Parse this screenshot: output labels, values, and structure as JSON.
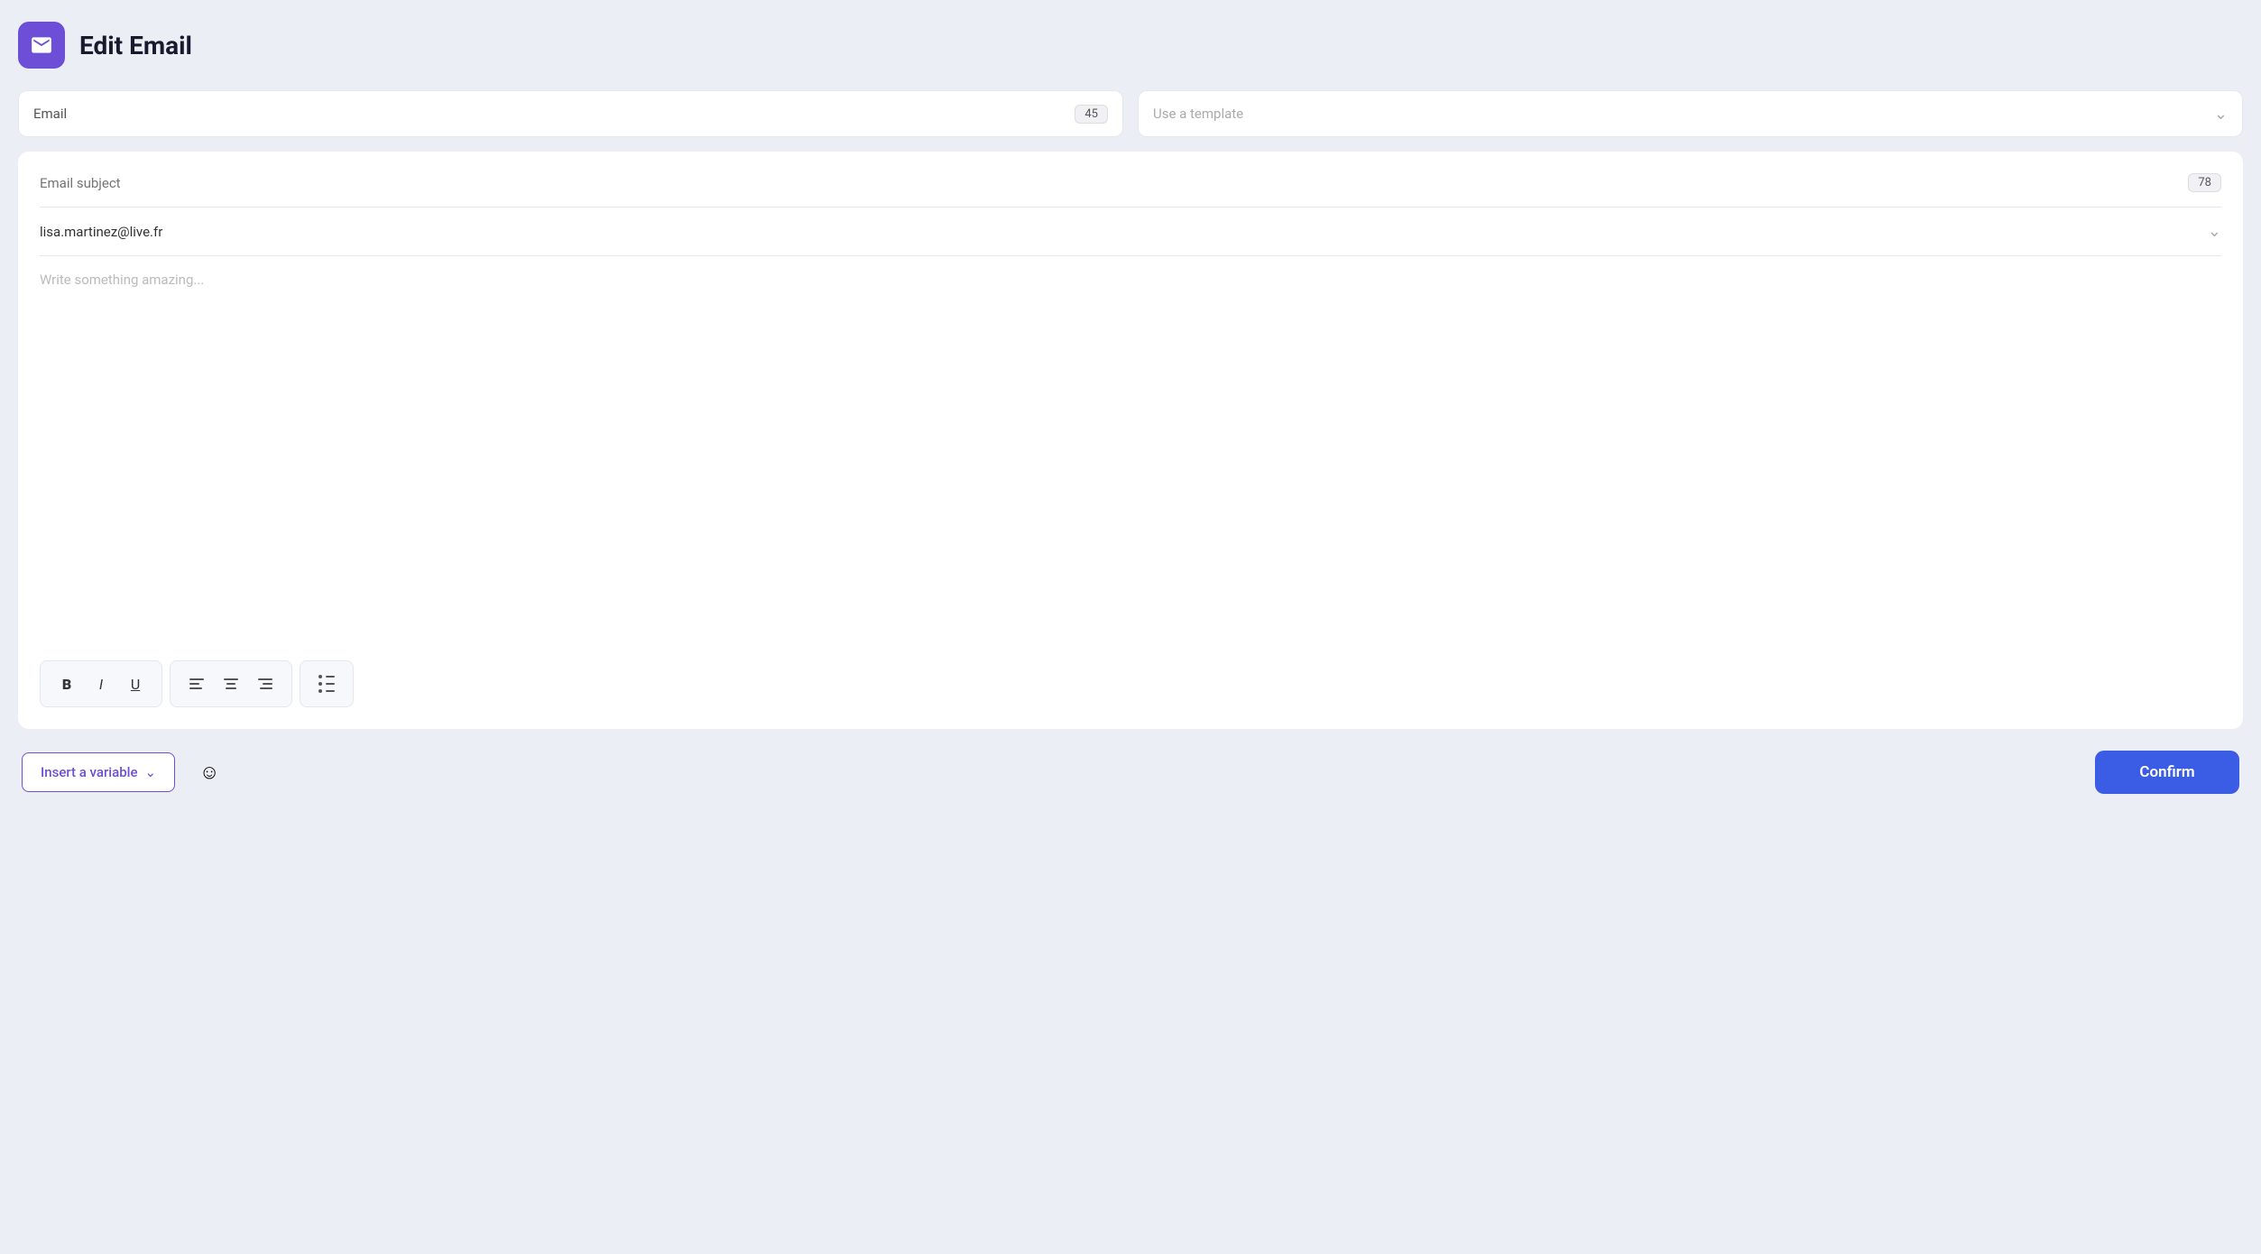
{
  "header": {
    "title": "Edit Email",
    "icon_name": "mail-icon"
  },
  "top_bar": {
    "email_tab": {
      "label": "Email",
      "badge": "45"
    },
    "template_select": {
      "placeholder": "Use a template",
      "chevron": "chevron-down-icon"
    }
  },
  "editor": {
    "subject": {
      "placeholder": "Email subject",
      "counter": "78"
    },
    "recipient": {
      "email": "lisa.martinez@live.fr"
    },
    "body": {
      "placeholder": "Write something amazing..."
    }
  },
  "toolbar": {
    "bold_label": "B",
    "italic_label": "I",
    "underline_label": "U"
  },
  "footer": {
    "insert_variable_label": "Insert a variable",
    "confirm_label": "Confirm"
  }
}
